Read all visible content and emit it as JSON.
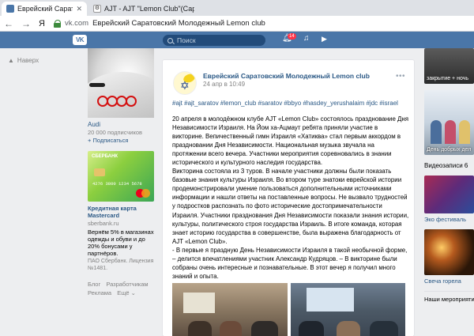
{
  "browser": {
    "tabs": [
      {
        "title": "Еврейский Саратовски",
        "icon": "vk-favicon",
        "active": true
      },
      {
        "title": "AJT - AJT \"Lemon Club\"(Сар",
        "icon": "ajt-favicon",
        "active": false
      }
    ],
    "nav": {
      "back": "←",
      "forward": "→",
      "yandex": "Я"
    },
    "url_host": "vk.com",
    "url_title": "Еврейский Саратовский Молодежный Lemon club"
  },
  "vk_header": {
    "logo": "VK",
    "search_placeholder": "Поиск",
    "notifications_count": "14"
  },
  "left_nav": {
    "back_label": "Наверх"
  },
  "ads": {
    "audi": {
      "name": "Audi",
      "subscribers": "20 000 подписчиков",
      "subscribe": "+ Подписаться"
    },
    "card": {
      "card_brand": "СБЕРБАНК",
      "card_number": "4276 3800 1234 5678",
      "title": "Кредитная карта Mastercard",
      "domain": "sberbank.ru",
      "text": "Вернём 5% в магазинах одежды и обуви и до 20% бонусами у партнёров.",
      "legal": "ПАО Сбербанк. Лицензия №1481."
    },
    "footer": [
      "Блог",
      "Разработчикам",
      "Реклама",
      "Ещё ⌄"
    ]
  },
  "post": {
    "author": "Еврейский Саратовский Молодежный Lemon club",
    "date": "24 апр в 10:49",
    "more": "•••",
    "tags": "#ajt #ajt_saratov #lemon_club #saratov #bbyo #hasdey_yerushalaim #jdc #israel",
    "paragraphs": [
      "20 апреля в молодёжном клубе AJT «Lemon Club» состоялось празднование Дня Независимости Израиля. На Йом ха-Ацмаут ребята приняли участие в викторине. Вепичественный гимн Израиля «Хатиква» стал первым аккордом в праздновании Дня Независимости. Национальная музыка звучала на протяжении всего вечера. Участники мероприятия соревновались в знании исторического и культурного наследия государства.",
      "Викторина состояла из 3 туров. В начале участники должны были показать базовые знания культуры Израиля. Во втором туре знатоки еврейской истории продемонстрировали умение пользоваться дополнительными источниками информации и нашли ответы на поставленные вопросы. Не вызвало трудностей у подростков распознать по фото исторические достопримечательности Израиля. Участники празднования Дня Независимости показали знания истории, культуры, политического строя государства Израиль. В итоге команда, которая знает историю государства в совершенстве, была выражена благодарность от AJT «Lemon Club».",
      "- В первые я праздную День Независимости Израиля в такой необычной форме, – делится впечатлениями участник Александр Кудряцов. – В викторине были собраны очень интересные и познавательные. В этот вечер я получил много знаний и опыта."
    ]
  },
  "right_col": {
    "thumb1_caption": "закрытие + ночь",
    "thumb2_caption": "День добрых дел",
    "videos_heading": "Видеозаписи 6",
    "video1_caption": "Эко фестиваль",
    "video2_caption": "Свеча горела",
    "next_heading": "Наши мероприятия"
  },
  "colors": {
    "vk_blue": "#4a76a8",
    "link_blue": "#2a5885",
    "badge_red": "#ff3347",
    "page_bg": "#edeef0"
  }
}
